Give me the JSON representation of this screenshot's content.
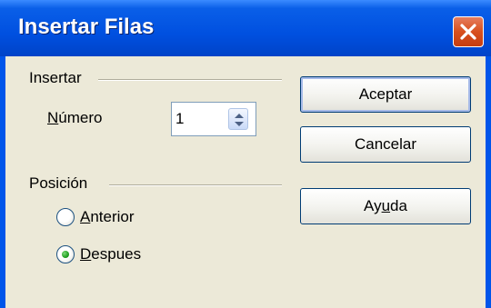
{
  "window": {
    "title": "Insertar Filas"
  },
  "insert_group": {
    "label": "Insertar",
    "number_label_accel": "N",
    "number_label_rest": "úmero",
    "number_value": "1"
  },
  "position_group": {
    "label": "Posición",
    "options": [
      {
        "accel": "A",
        "rest": "nterior",
        "selected": false
      },
      {
        "accel": "D",
        "rest": "espues",
        "selected": true
      }
    ]
  },
  "buttons": {
    "ok": "Aceptar",
    "cancel": "Cancelar",
    "help_pre": "Ay",
    "help_accel": "u",
    "help_post": "da"
  },
  "icons": {
    "close": "close-icon",
    "spin_up": "spin-up-icon",
    "spin_down": "spin-down-icon"
  },
  "colors": {
    "titlebar": "#0055EA",
    "close_button": "#D8501E",
    "dialog_face": "#ECE9D8",
    "radio_selected": "#21A121"
  }
}
